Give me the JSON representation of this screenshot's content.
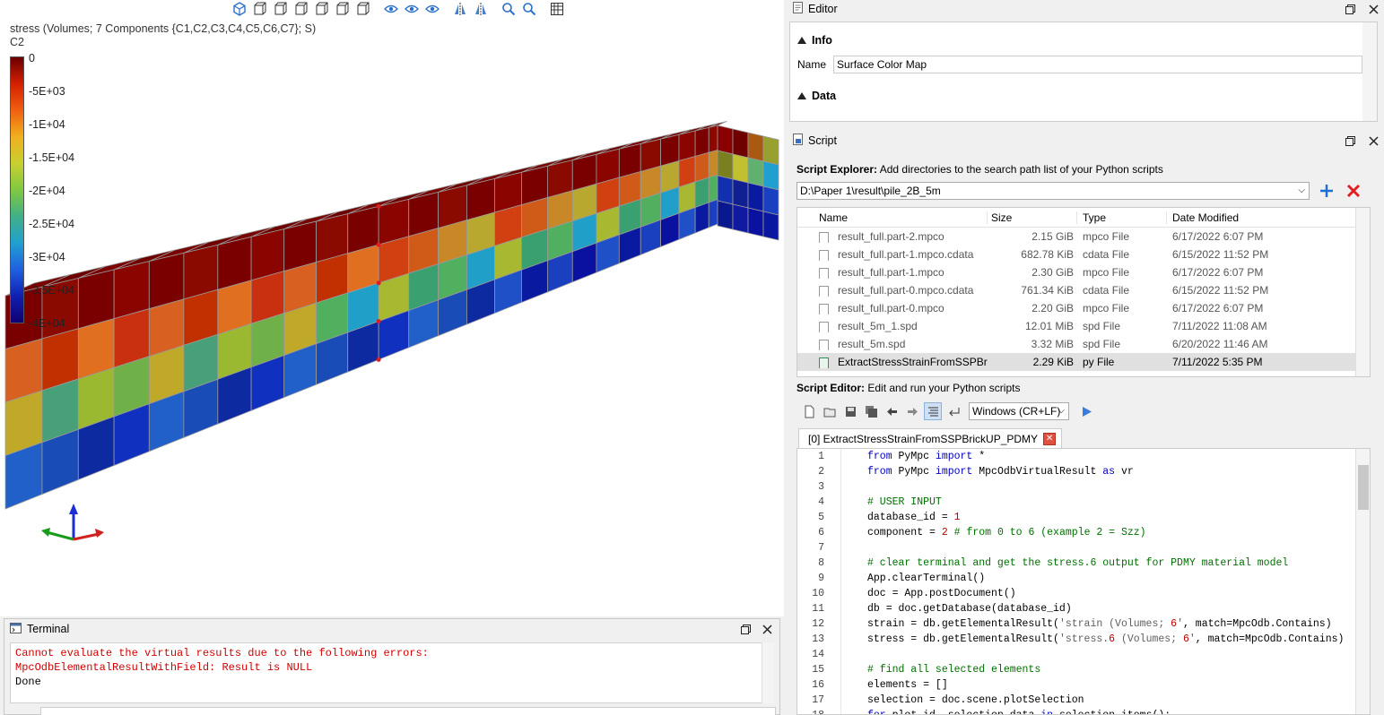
{
  "viewport": {
    "result_title": "stress (Volumes; 7 Components {C1,C2,C3,C4,C5,C6,C7}; S)",
    "component": "C2",
    "colorbar_labels": [
      "0",
      "-5E+03",
      "-1E+04",
      "-1.5E+04",
      "-2E+04",
      "-2.5E+04",
      "-3E+04",
      "-3.5E+04",
      "-4E+04"
    ],
    "toolbar_icons": [
      "iso-view-icon",
      "front-view-icon",
      "back-view-icon",
      "left-view-icon",
      "right-view-icon",
      "top-view-icon",
      "bottom-view-icon",
      "display-mode-icon",
      "show-icon",
      "hide-icon",
      "mirror-icon",
      "split-icon",
      "zoom-fit-icon",
      "zoom-icon",
      "grid-icon"
    ]
  },
  "terminal": {
    "title": "Terminal",
    "lines": [
      {
        "text": "Cannot evaluate the virtual results due to the following errors:",
        "kind": "error"
      },
      {
        "text": "MpcOdbElementalResultWithField: Result is NULL",
        "kind": "error"
      },
      {
        "text": "Done",
        "kind": "normal"
      }
    ]
  },
  "editor": {
    "title": "Editor",
    "info_label": "Info",
    "name_label": "Name",
    "name_value": "Surface Color Map",
    "data_label": "Data"
  },
  "script": {
    "title": "Script",
    "explorer_label": "Script Explorer:",
    "explorer_desc": "Add directories to the search path list of your Python scripts",
    "path": "D:\\Paper 1\\result\\pile_2B_5m",
    "columns": {
      "name": "Name",
      "size": "Size",
      "type": "Type",
      "date": "Date Modified"
    },
    "files": [
      {
        "name": "result_full.part-2.mpco",
        "size": "2.15 GiB",
        "type": "mpco File",
        "date": "6/17/2022 6:07 PM"
      },
      {
        "name": "result_full.part-1.mpco.cdata",
        "size": "682.78 KiB",
        "type": "cdata File",
        "date": "6/15/2022 11:52 PM"
      },
      {
        "name": "result_full.part-1.mpco",
        "size": "2.30 GiB",
        "type": "mpco File",
        "date": "6/17/2022 6:07 PM"
      },
      {
        "name": "result_full.part-0.mpco.cdata",
        "size": "761.34 KiB",
        "type": "cdata File",
        "date": "6/15/2022 11:52 PM"
      },
      {
        "name": "result_full.part-0.mpco",
        "size": "2.20 GiB",
        "type": "mpco File",
        "date": "6/17/2022 6:07 PM"
      },
      {
        "name": "result_5m_1.spd",
        "size": "12.01 MiB",
        "type": "spd File",
        "date": "7/11/2022 11:08 AM"
      },
      {
        "name": "result_5m.spd",
        "size": "3.32 MiB",
        "type": "spd File",
        "date": "6/20/2022 11:46 AM"
      },
      {
        "name": "ExtractStressStrainFromSSPBr...",
        "size": "2.29 KiB",
        "type": "py File",
        "date": "7/11/2022 5:35 PM"
      }
    ],
    "editor_label": "Script Editor:",
    "editor_desc": "Edit and run your Python scripts",
    "eol": "Windows (CR+LF)",
    "tab_label": "[0] ExtractStressStrainFromSSPBrickUP_PDMY",
    "code": [
      "from PyMpc import *",
      "from PyMpc import MpcOdbVirtualResult as vr",
      "",
      "# USER INPUT",
      "database_id = 1",
      "component = 2 # from 0 to 6 (example 2 = Szz)",
      "",
      "# clear terminal and get the stress.6 output for PDMY material model",
      "App.clearTerminal()",
      "doc = App.postDocument()",
      "db = doc.getDatabase(database_id)",
      "strain = db.getElementalResult('strain (Volumes; 6', match=MpcOdb.Contains)",
      "stress = db.getElementalResult('stress.6 (Volumes; 6', match=MpcOdb.Contains)",
      "",
      "# find all selected elements",
      "elements = []",
      "selection = doc.scene.plotSelection",
      "for plot_id, selection_data in selection.items():"
    ]
  },
  "colors": {
    "accent_blue": "#1e6fd0",
    "error_red": "#d00000",
    "comment_green": "#007000",
    "keyword_blue": "#0000c0"
  }
}
